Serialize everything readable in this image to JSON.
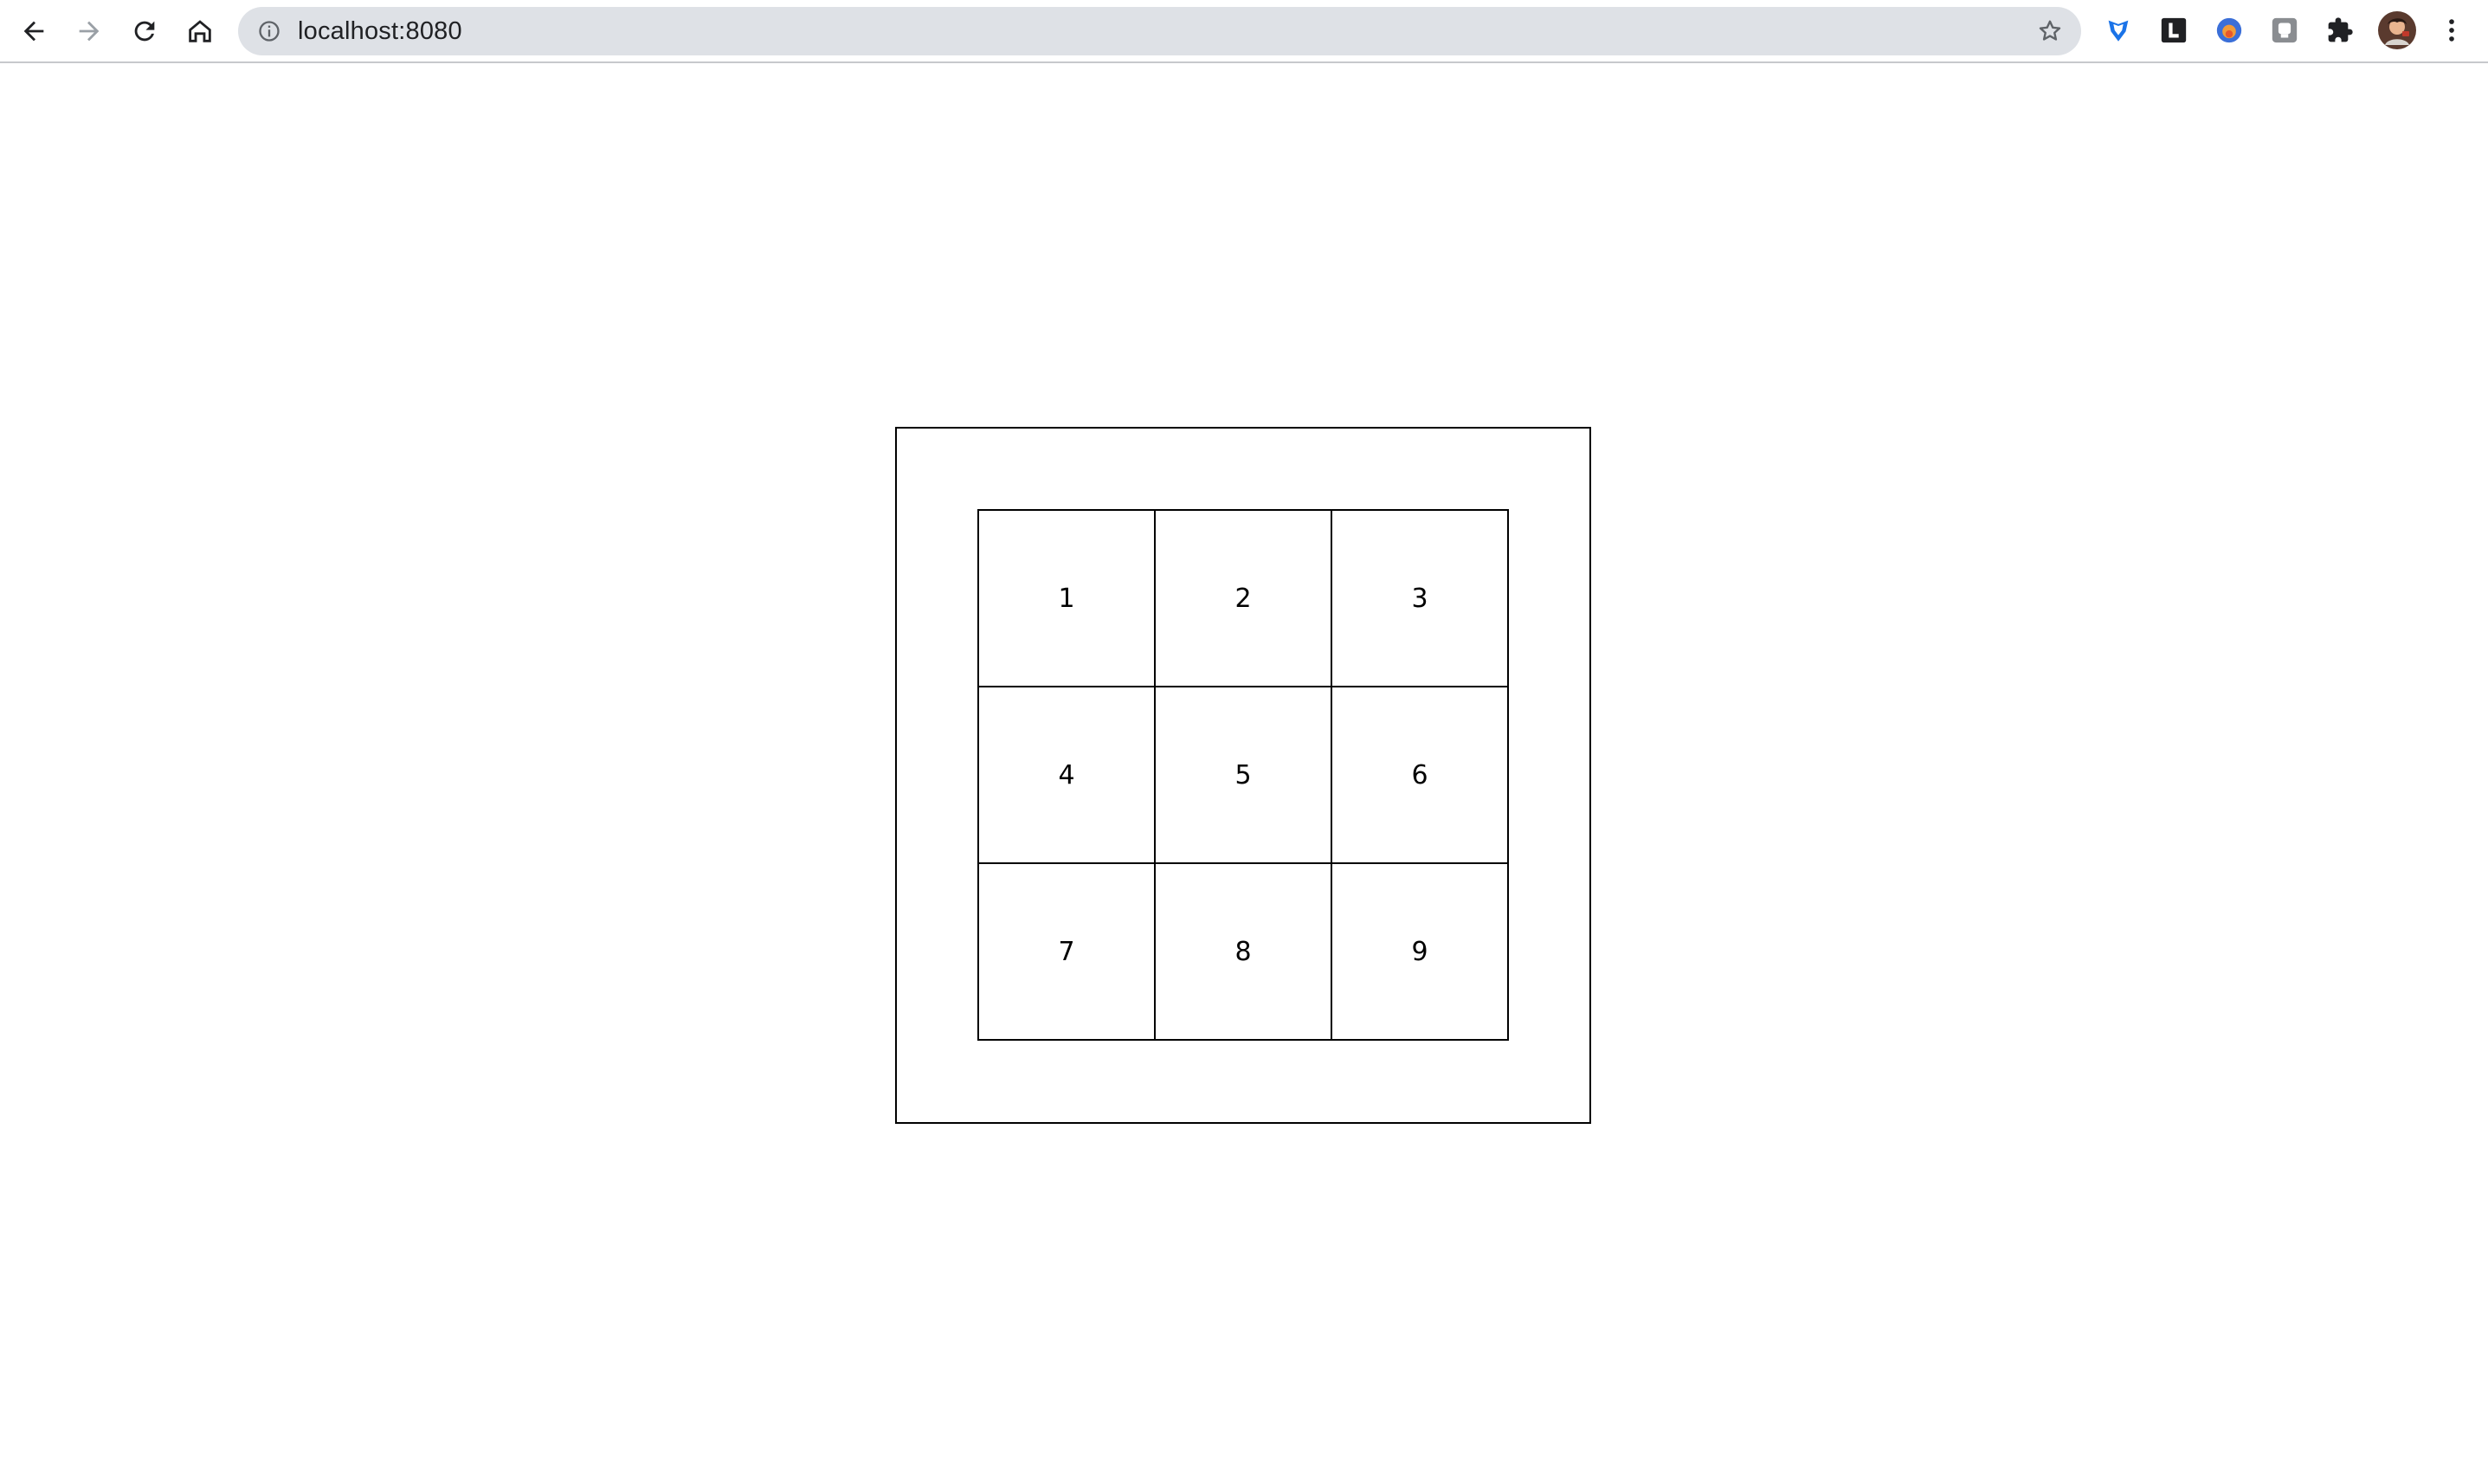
{
  "browser": {
    "url": "localhost:8080",
    "icons": {
      "back": "back-arrow-icon",
      "forward": "forward-arrow-icon",
      "reload": "reload-icon",
      "home": "home-icon",
      "site_info": "info-icon",
      "bookmark": "star-icon",
      "menu": "kebab-menu-icon"
    },
    "extensions": [
      {
        "name": "shield-extension-icon",
        "color": "#1a73e8"
      },
      {
        "name": "l-extension-icon",
        "color": "#202124"
      },
      {
        "name": "fox-extension-icon",
        "color": "#3b6fd8"
      },
      {
        "name": "grey-extension-icon",
        "color": "#8a8d91"
      },
      {
        "name": "puzzle-extensions-icon",
        "color": "#202124"
      }
    ],
    "profile": "avatar"
  },
  "grid": {
    "cells": [
      "1",
      "2",
      "3",
      "4",
      "5",
      "6",
      "7",
      "8",
      "9"
    ]
  }
}
